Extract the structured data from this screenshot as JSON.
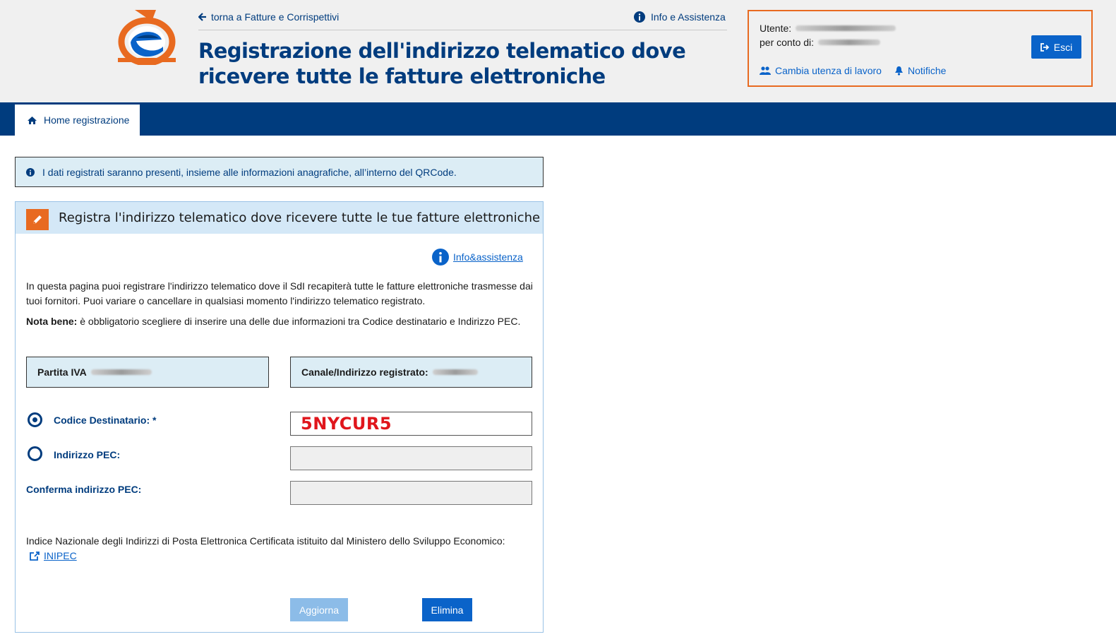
{
  "header": {
    "back_link": "torna a Fatture e Corrispettivi",
    "info_link": "Info e Assistenza",
    "title": "Registrazione dell'indirizzo telematico dove ricevere tutte le fatture elettroniche"
  },
  "user": {
    "utente_label": "Utente:",
    "per_conto_label": "per conto di:",
    "exit_label": "Esci",
    "change_label": "Cambia utenza di lavoro",
    "notifications_label": "Notifiche"
  },
  "nav": {
    "home_label": "Home registrazione"
  },
  "notice": {
    "text": "I dati registrati saranno presenti, insieme alle informazioni anagrafiche, all’interno del QRCode."
  },
  "panel": {
    "title": "Registra l'indirizzo telematico dove ricevere tutte le tue fatture elettroniche",
    "info_link": "Info&assistenza",
    "description": "In questa pagina puoi registrare l'indirizzo telematico dove il SdI recapiterà tutte le fatture elettroniche trasmesse dai tuoi fornitori. Puoi variare o cancellare in qualsiasi momento l'indirizzo telematico registrato.",
    "nota_label": "Nota bene:",
    "nota_text": " è obbligatorio scegliere di inserire una delle due informazioni tra Codice destinatario e Indirizzo PEC.",
    "partita_iva_label": "Partita IVA",
    "canale_label": "Canale/Indirizzo registrato:",
    "codice_label": "Codice Destinatario: *",
    "codice_value": "5NYCUR5",
    "pec_label": "Indirizzo PEC:",
    "pec_confirm_label": "Conferma indirizzo PEC:",
    "inipec_text": "Indice Nazionale degli Indirizzi di Posta Elettronica Certificata istituito dal Ministero dello Sviluppo Economico:",
    "inipec_link": "INIPEC",
    "update_label": "Aggiorna",
    "delete_label": "Elimina"
  },
  "colors": {
    "brand_blue": "#003c7e",
    "accent_orange": "#e86a20",
    "button_blue": "#0a63c9",
    "highlight_red": "#e0161c"
  }
}
